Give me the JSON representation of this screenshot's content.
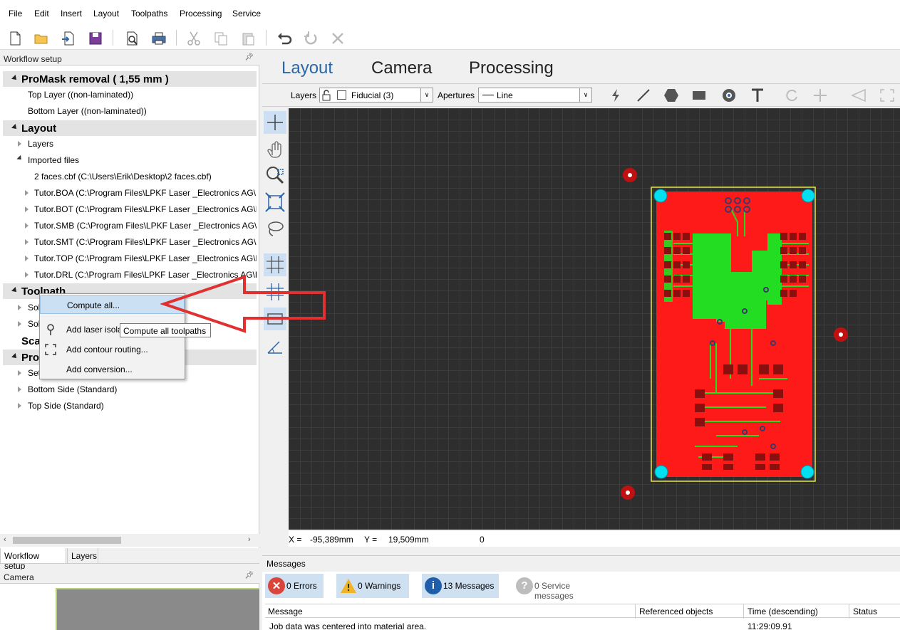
{
  "menu": {
    "items": [
      "File",
      "Edit",
      "Insert",
      "Layout",
      "Toolpaths",
      "Processing",
      "Service"
    ]
  },
  "toolbar": {
    "icons": [
      "new-file-icon",
      "open-folder-icon",
      "import-icon",
      "save-icon",
      "print-preview-icon",
      "print-icon",
      "cut-icon",
      "copy-icon",
      "paste-icon",
      "undo-icon",
      "redo-icon",
      "delete-icon"
    ]
  },
  "workflow": {
    "title": "Workflow setup",
    "pin": "⌂",
    "sections": {
      "promask": "ProMask removal ( 1,55 mm )",
      "layout": "Layout",
      "toolpath": "Toolpath",
      "scaling": "Sca",
      "processing": "Pro"
    },
    "promask_items": [
      "Top Layer ((non-laminated))",
      "Bottom Layer ((non-laminated))"
    ],
    "layers_label": "Layers",
    "imported_label": "Imported files",
    "imported_files": [
      "2 faces.cbf (C:\\Users\\Erik\\Desktop\\2 faces.cbf)",
      "Tutor.BOA (C:\\Program Files\\LPKF Laser _Electronics AG\\LPK",
      "Tutor.BOT (C:\\Program Files\\LPKF Laser _Electronics AG\\LPK",
      "Tutor.SMB (C:\\Program Files\\LPKF Laser _Electronics AG\\LPK",
      "Tutor.SMT (C:\\Program Files\\LPKF Laser _Electronics AG\\LPK",
      "Tutor.TOP (C:\\Program Files\\LPKF Laser _Electronics AG\\LPK",
      "Tutor.DRL (C:\\Program Files\\LPKF Laser _Electronics AG\\LPK"
    ],
    "toolpath_items": [
      "Sol",
      "Sol"
    ],
    "processing_items": [
      "Set",
      "Bottom Side (Standard)",
      "Top Side (Standard)"
    ]
  },
  "context_menu": {
    "items": [
      "Compute all...",
      "Add laser isola",
      "Add contour routing...",
      "Add conversion..."
    ],
    "tooltip": "Compute all toolpaths"
  },
  "bottom_tabs": [
    "Workflow setup",
    "Layers"
  ],
  "camera": {
    "title": "Camera"
  },
  "main_tabs": [
    "Layout",
    "Camera",
    "Processing"
  ],
  "layer_bar": {
    "layers_label": "Layers",
    "layer_value": "Fiducial (3)",
    "apertures_label": "Apertures",
    "aperture_value": "Line"
  },
  "coords": {
    "x_label": "X =",
    "x_value": "-95,389mm",
    "y_label": "Y =",
    "y_value": "19,509mm",
    "extra": "0"
  },
  "messages": {
    "title": "Messages",
    "errors": "0 Errors",
    "warnings": "0 Warnings",
    "messages": "13 Messages",
    "service": "0 Service messages",
    "columns": [
      "Message",
      "Referenced objects",
      "Time (descending)",
      "Status"
    ],
    "row": {
      "message": "Job data was centered into material area.",
      "time": "11:29:09.91"
    }
  },
  "colors": {
    "pcb_red": "#ff1a1a",
    "trace_green": "#22dd22",
    "fiducial_cyan": "#00e0f0",
    "accent": "#2a66a8",
    "arrow": "#e03030"
  }
}
